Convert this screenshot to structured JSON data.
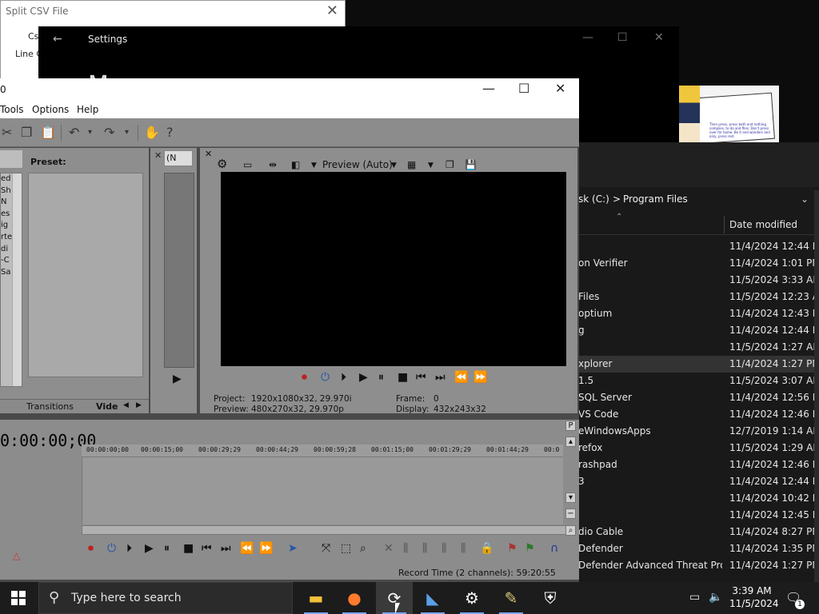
{
  "csv_window": {
    "title": "Split CSV File",
    "label_cs": "Cs",
    "label_line": "Line C"
  },
  "settings_window": {
    "title": "Settings",
    "heading_fragment": "M"
  },
  "comic": {
    "caption": "Then press, press both and nothing complies, to do and files. Don't press over for home. Be it and wonders and only, press rest"
  },
  "explorer": {
    "breadcrumb": [
      "sk (C:)",
      ">",
      "Program Files"
    ],
    "column_date": "Date modified",
    "rows": [
      {
        "name": "",
        "date": "11/4/2024 12:44 PM"
      },
      {
        "name": "on Verifier",
        "date": "11/4/2024 1:01 PM"
      },
      {
        "name": "",
        "date": "11/5/2024 3:33 AM"
      },
      {
        "name": "Files",
        "date": "11/5/2024 12:23 AM"
      },
      {
        "name": "optium",
        "date": "11/4/2024 12:43 PM"
      },
      {
        "name": "g",
        "date": "11/4/2024 12:44 PM"
      },
      {
        "name": "",
        "date": "11/5/2024 1:27 AM"
      },
      {
        "name": "xplorer",
        "date": "11/4/2024 1:27 PM",
        "selected": true
      },
      {
        "name": "1.5",
        "date": "11/5/2024 3:07 AM"
      },
      {
        "name": "SQL Server",
        "date": "11/4/2024 12:56 PM"
      },
      {
        "name": "VS Code",
        "date": "11/4/2024 12:46 PM"
      },
      {
        "name": "eWindowsApps",
        "date": "12/7/2019 1:14 AM"
      },
      {
        "name": "refox",
        "date": "11/5/2024 1:29 AM"
      },
      {
        "name": "rashpad",
        "date": "11/4/2024 12:46 PM"
      },
      {
        "name": "3",
        "date": "11/4/2024 12:44 PM"
      },
      {
        "name": "",
        "date": "11/4/2024 10:42 PM"
      },
      {
        "name": "",
        "date": "11/4/2024 12:45 PM"
      },
      {
        "name": "dio Cable",
        "date": "11/4/2024 8:27 PM"
      },
      {
        "name": "Defender",
        "date": "11/4/2024 1:35 PM"
      },
      {
        "name": "Defender Advanced Threat Prot...",
        "date": "11/4/2024 1:27 PM"
      }
    ]
  },
  "vegas": {
    "title_fragment": "0",
    "menu": [
      "Tools",
      "Options",
      "Help"
    ],
    "preset_label": "Preset:",
    "left_list": [
      "ed",
      "Sh",
      "N",
      "es",
      "ig",
      "rte",
      "di",
      "",
      "",
      "-C",
      "Sa"
    ],
    "tabs": [
      "Transitions",
      "Vide"
    ],
    "trim_select": "(N",
    "preview_mode": "Preview (Auto)",
    "project_label": "Project:",
    "project_value": "1920x1080x32, 29.970i",
    "preview_label": "Preview:",
    "preview_value": "480x270x32, 29.970p",
    "frame_label": "Frame:",
    "frame_value": "0",
    "display_label": "Display:",
    "display_value": "432x243x32",
    "timecode": "0:00:00;00",
    "ruler": [
      "00:00:00;00",
      "00:00:15;00",
      "00:00:29;29",
      "00:00:44;29",
      "00:00:59;28",
      "00:01:15;00",
      "00:01:29;29",
      "00:01:44;29",
      "00:0"
    ],
    "record_time": "Record Time (2 channels): 59:20:55"
  },
  "taskbar": {
    "search_placeholder": "Type here to search",
    "time": "3:39 AM",
    "date": "11/5/2024",
    "notification_count": "1"
  },
  "colors": {
    "vegas_panel": "#8e8e8e",
    "explorer_bg": "#191919",
    "taskbar_bg": "#1c1c1c",
    "preview_screen": "#000000"
  }
}
